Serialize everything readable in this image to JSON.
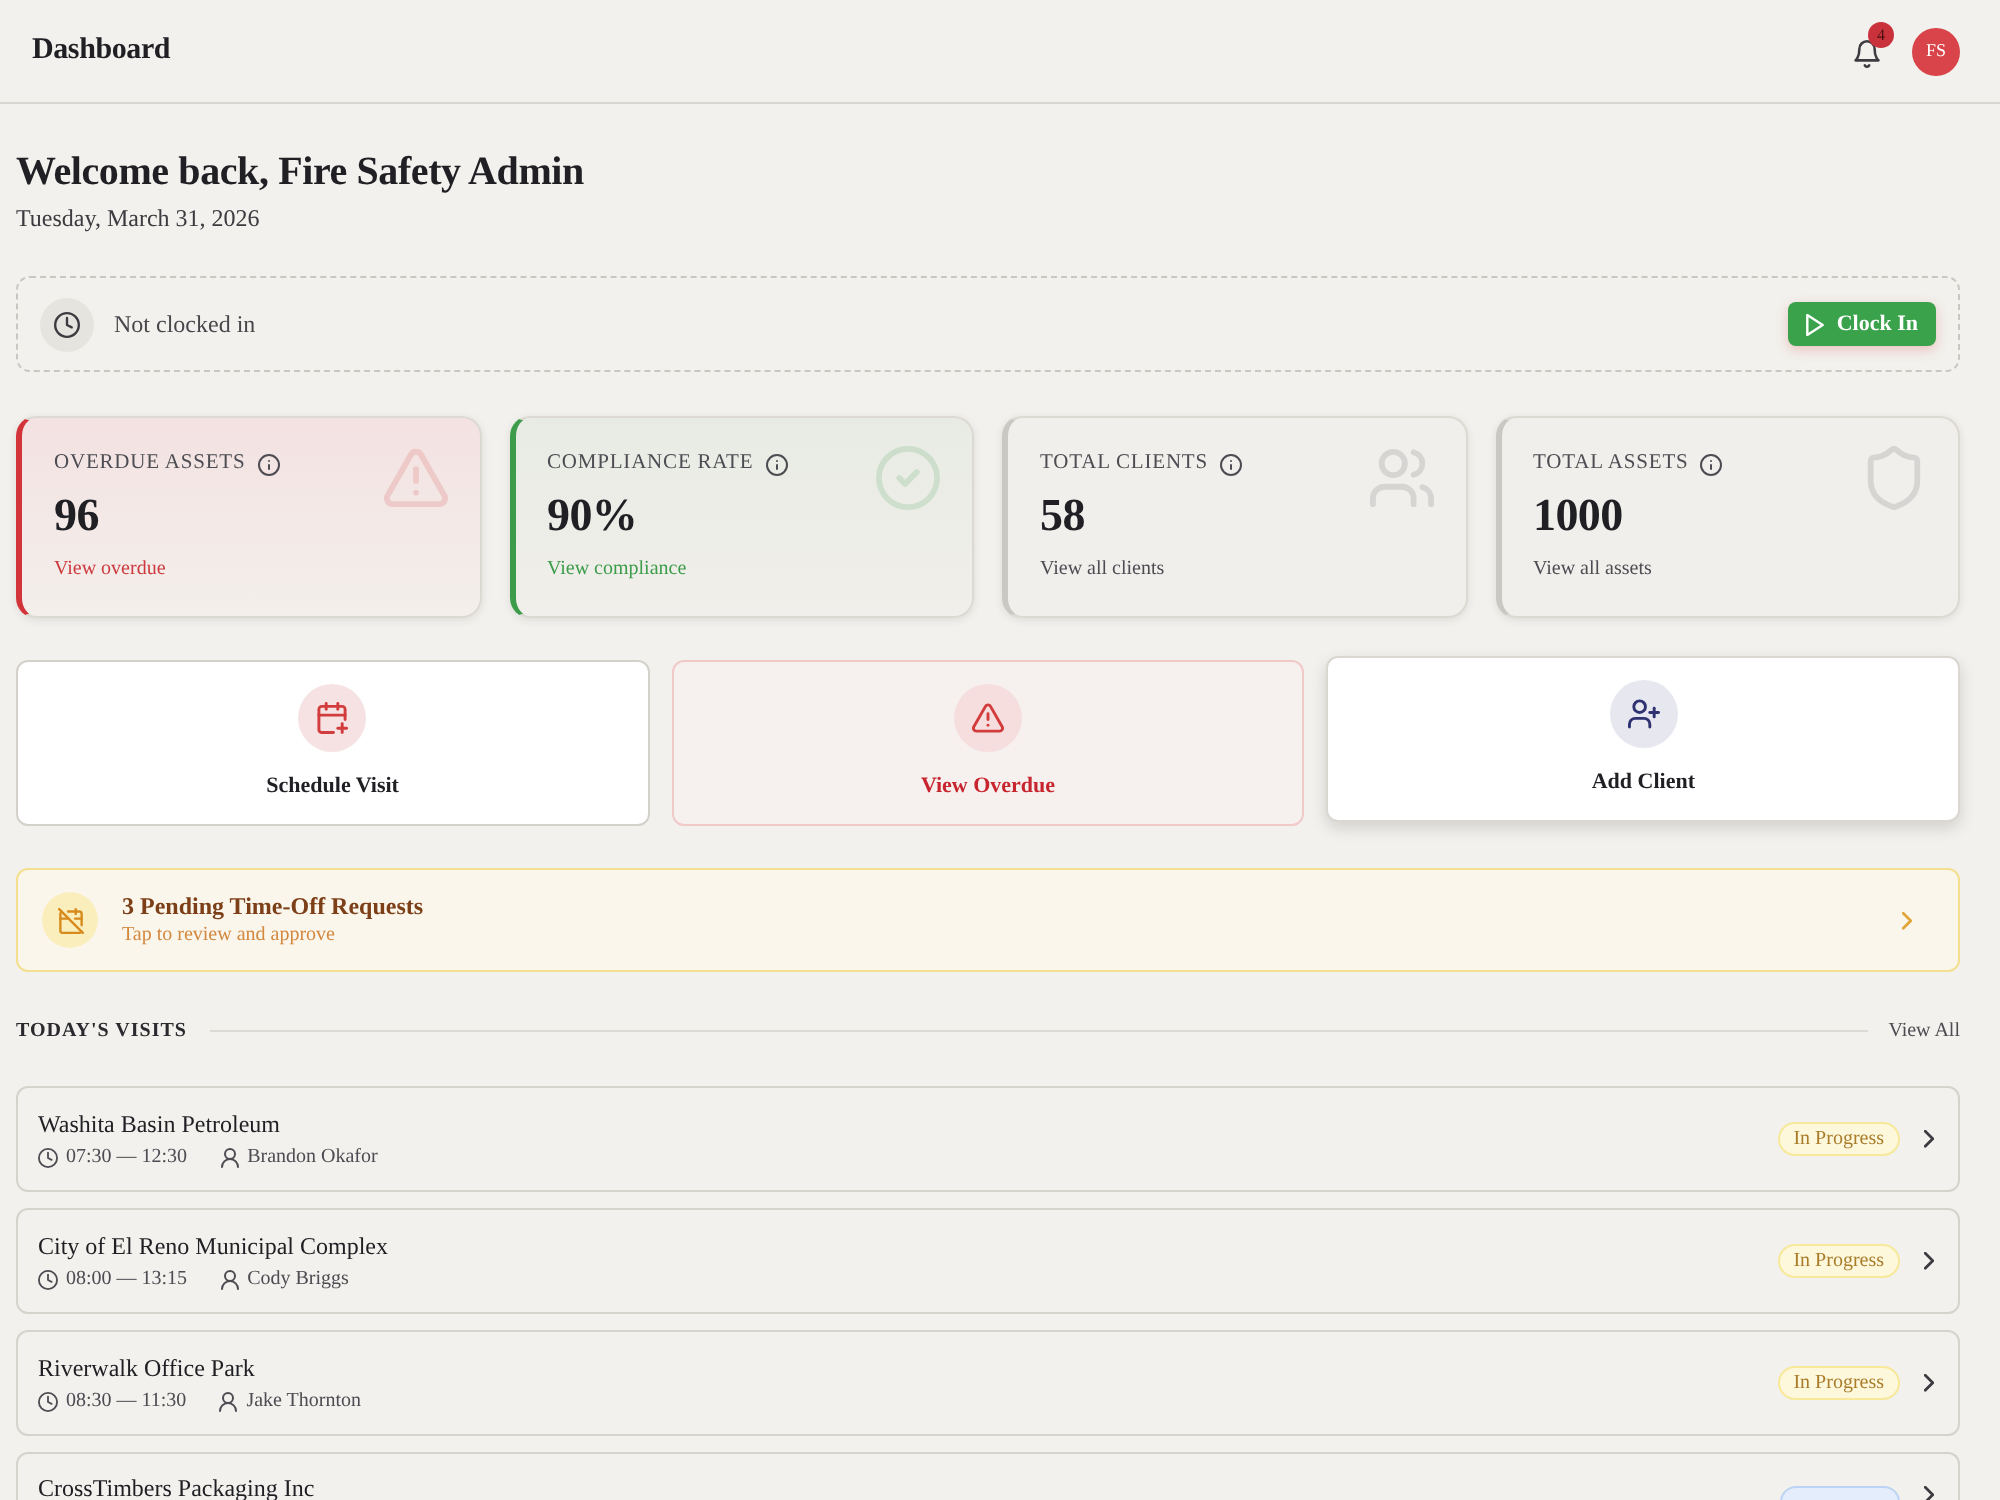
{
  "header": {
    "title": "Dashboard",
    "notifications": {
      "count": "4"
    },
    "avatar": {
      "initials": "FS"
    }
  },
  "welcome": {
    "title": "Welcome back, Fire Safety Admin",
    "date": "Tuesday, March 31, 2026"
  },
  "clock": {
    "status": "Not clocked in",
    "button": "Clock In"
  },
  "stats": [
    {
      "kind": "overdue",
      "label": "OVERDUE ASSETS",
      "value": "96",
      "link": "View overdue"
    },
    {
      "kind": "compliance",
      "label": "COMPLIANCE RATE",
      "value": "90%",
      "link": "View compliance"
    },
    {
      "kind": "clients",
      "label": "TOTAL CLIENTS",
      "value": "58",
      "link": "View all clients"
    },
    {
      "kind": "assets",
      "label": "TOTAL ASSETS",
      "value": "1000",
      "link": "View all assets"
    }
  ],
  "actions": [
    {
      "kind": "schedule",
      "label": "Schedule Visit",
      "hovered": false
    },
    {
      "kind": "overdue",
      "label": "View Overdue",
      "hovered": false
    },
    {
      "kind": "client",
      "label": "Add Client",
      "hovered": true
    }
  ],
  "time_off": {
    "title": "3 Pending Time-Off Requests",
    "subtitle": "Tap to review and approve"
  },
  "visits_section": {
    "title": "TODAY'S VISITS",
    "link": "View All"
  },
  "visits": [
    {
      "name": "Washita Basin Petroleum",
      "time": "07:30 — 12:30",
      "technician": "Brandon Okafor",
      "status": {
        "kind": "in_progress",
        "label": "In Progress"
      }
    },
    {
      "name": "City of El Reno Municipal Complex",
      "time": "08:00 — 13:15",
      "technician": "Cody Briggs",
      "status": {
        "kind": "in_progress",
        "label": "In Progress"
      }
    },
    {
      "name": "Riverwalk Office Park",
      "time": "08:30 — 11:30",
      "technician": "Jake Thornton",
      "status": {
        "kind": "in_progress",
        "label": "In Progress"
      }
    },
    {
      "name": "CrossTimbers Packaging Inc",
      "status": {
        "kind": "scheduled"
      }
    }
  ]
}
